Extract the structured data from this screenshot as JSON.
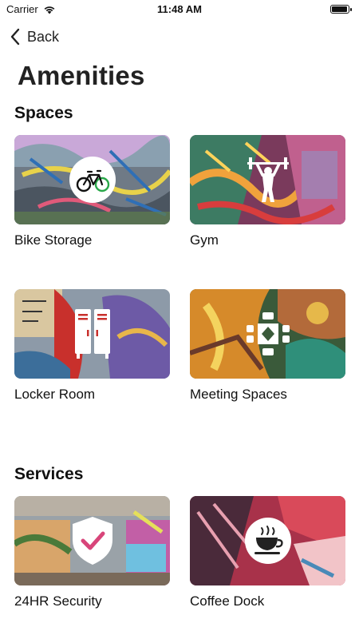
{
  "status_bar": {
    "carrier": "Carrier",
    "time": "11:48 AM"
  },
  "nav": {
    "back_label": "Back"
  },
  "page": {
    "title": "Amenities"
  },
  "sections": [
    {
      "title": "Spaces",
      "items": [
        {
          "label": "Bike Storage",
          "icon": "bicycle-icon"
        },
        {
          "label": "Gym",
          "icon": "weightlifter-icon"
        },
        {
          "label": "Locker Room",
          "icon": "locker-icon"
        },
        {
          "label": "Meeting Spaces",
          "icon": "meeting-table-icon"
        }
      ]
    },
    {
      "title": "Services",
      "items": [
        {
          "label": "24HR Security",
          "icon": "security-shield-icon"
        },
        {
          "label": "Coffee Dock",
          "icon": "coffee-cup-icon"
        }
      ]
    }
  ]
}
